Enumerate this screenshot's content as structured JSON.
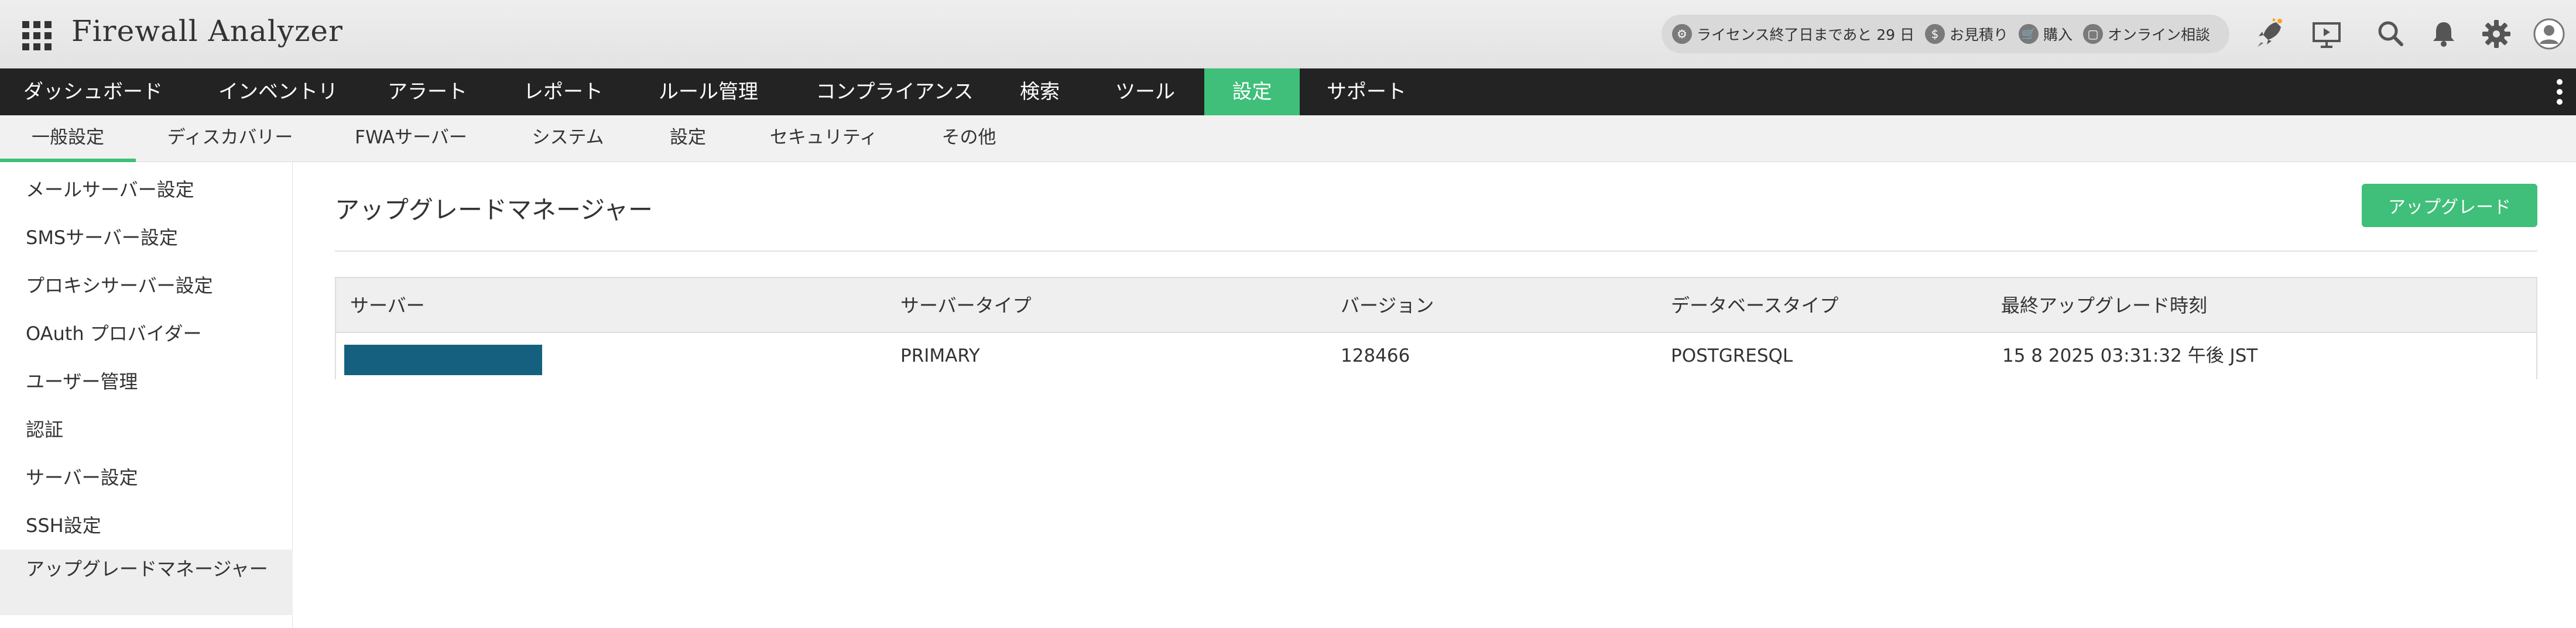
{
  "header": {
    "app_title": "Firewall Analyzer",
    "pill": {
      "license": "ライセンス終了日まであと 29 日",
      "quote": "お見積り",
      "purchase": "購入",
      "consult": "オンライン相談"
    },
    "icons": [
      "rocket-icon",
      "presentation-icon",
      "search-icon",
      "bell-icon",
      "gear-icon",
      "user-icon"
    ]
  },
  "mainnav": {
    "items": [
      "ダッシュボード",
      "インベントリ",
      "アラート",
      "レポート",
      "ルール管理",
      "コンプライアンス",
      "検索",
      "ツール",
      "設定",
      "サポート"
    ],
    "active_index": 8
  },
  "subnav": {
    "items": [
      "一般設定",
      "ディスカバリー",
      "FWAサーバー",
      "システム",
      "設定",
      "セキュリティ",
      "その他"
    ],
    "active_index": 0
  },
  "sidebar": {
    "items": [
      "メールサーバー設定",
      "SMSサーバー設定",
      "プロキシサーバー設定",
      "OAuth プロバイダー",
      "ユーザー管理",
      "認証",
      "サーバー設定",
      "SSH設定",
      "アップグレードマネージャー"
    ],
    "active_index": 8
  },
  "main": {
    "title": "アップグレードマネージャー",
    "upgrade_button": "アップグレード",
    "table": {
      "columns": [
        "サーバー",
        "サーバータイプ",
        "バージョン",
        "データベースタイプ",
        "最終アップグレード時刻"
      ],
      "rows": [
        {
          "server": "",
          "server_type": "PRIMARY",
          "version": "128466",
          "db_type": "POSTGRESQL",
          "last_upgrade": "15 8 2025 03:31:32 午後 JST"
        }
      ]
    }
  },
  "colors": {
    "accent": "#3fbf79",
    "nav_bg": "#232323",
    "redaction": "#15607f"
  }
}
